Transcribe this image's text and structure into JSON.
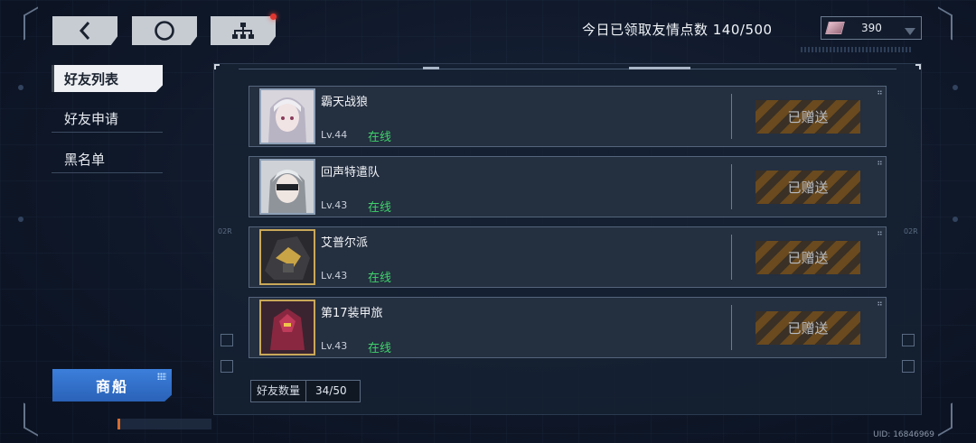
{
  "nav": {
    "back_icon": "chevron-left-icon",
    "home_icon": "circle-icon",
    "tree_icon": "hierarchy-icon"
  },
  "header": {
    "friendship_points": "今日已领取友情点数 140/500",
    "currency_amount": "390"
  },
  "tabs": [
    {
      "label": "好友列表",
      "active": true
    },
    {
      "label": "好友申请",
      "active": false
    },
    {
      "label": "黑名单",
      "active": false
    }
  ],
  "shop_button": "商船",
  "friends": [
    {
      "name": "霸天战狼",
      "level": "Lv.44",
      "status": "在线",
      "action": "已赠送"
    },
    {
      "name": "回声特遣队",
      "level": "Lv.43",
      "status": "在线",
      "action": "已赠送"
    },
    {
      "name": "艾普尔派",
      "level": "Lv.43",
      "status": "在线",
      "action": "已赠送"
    },
    {
      "name": "第17装甲旅",
      "level": "Lv.43",
      "status": "在线",
      "action": "已赠送"
    }
  ],
  "friend_count": {
    "label": "好友数量",
    "value": "34/50"
  },
  "side_labels": {
    "left": "02R",
    "right": "02R"
  },
  "uid": "UID: 16846969",
  "colors": {
    "online": "#3fd36a",
    "shop": "#2f6fcf",
    "notif": "#e2372f"
  }
}
